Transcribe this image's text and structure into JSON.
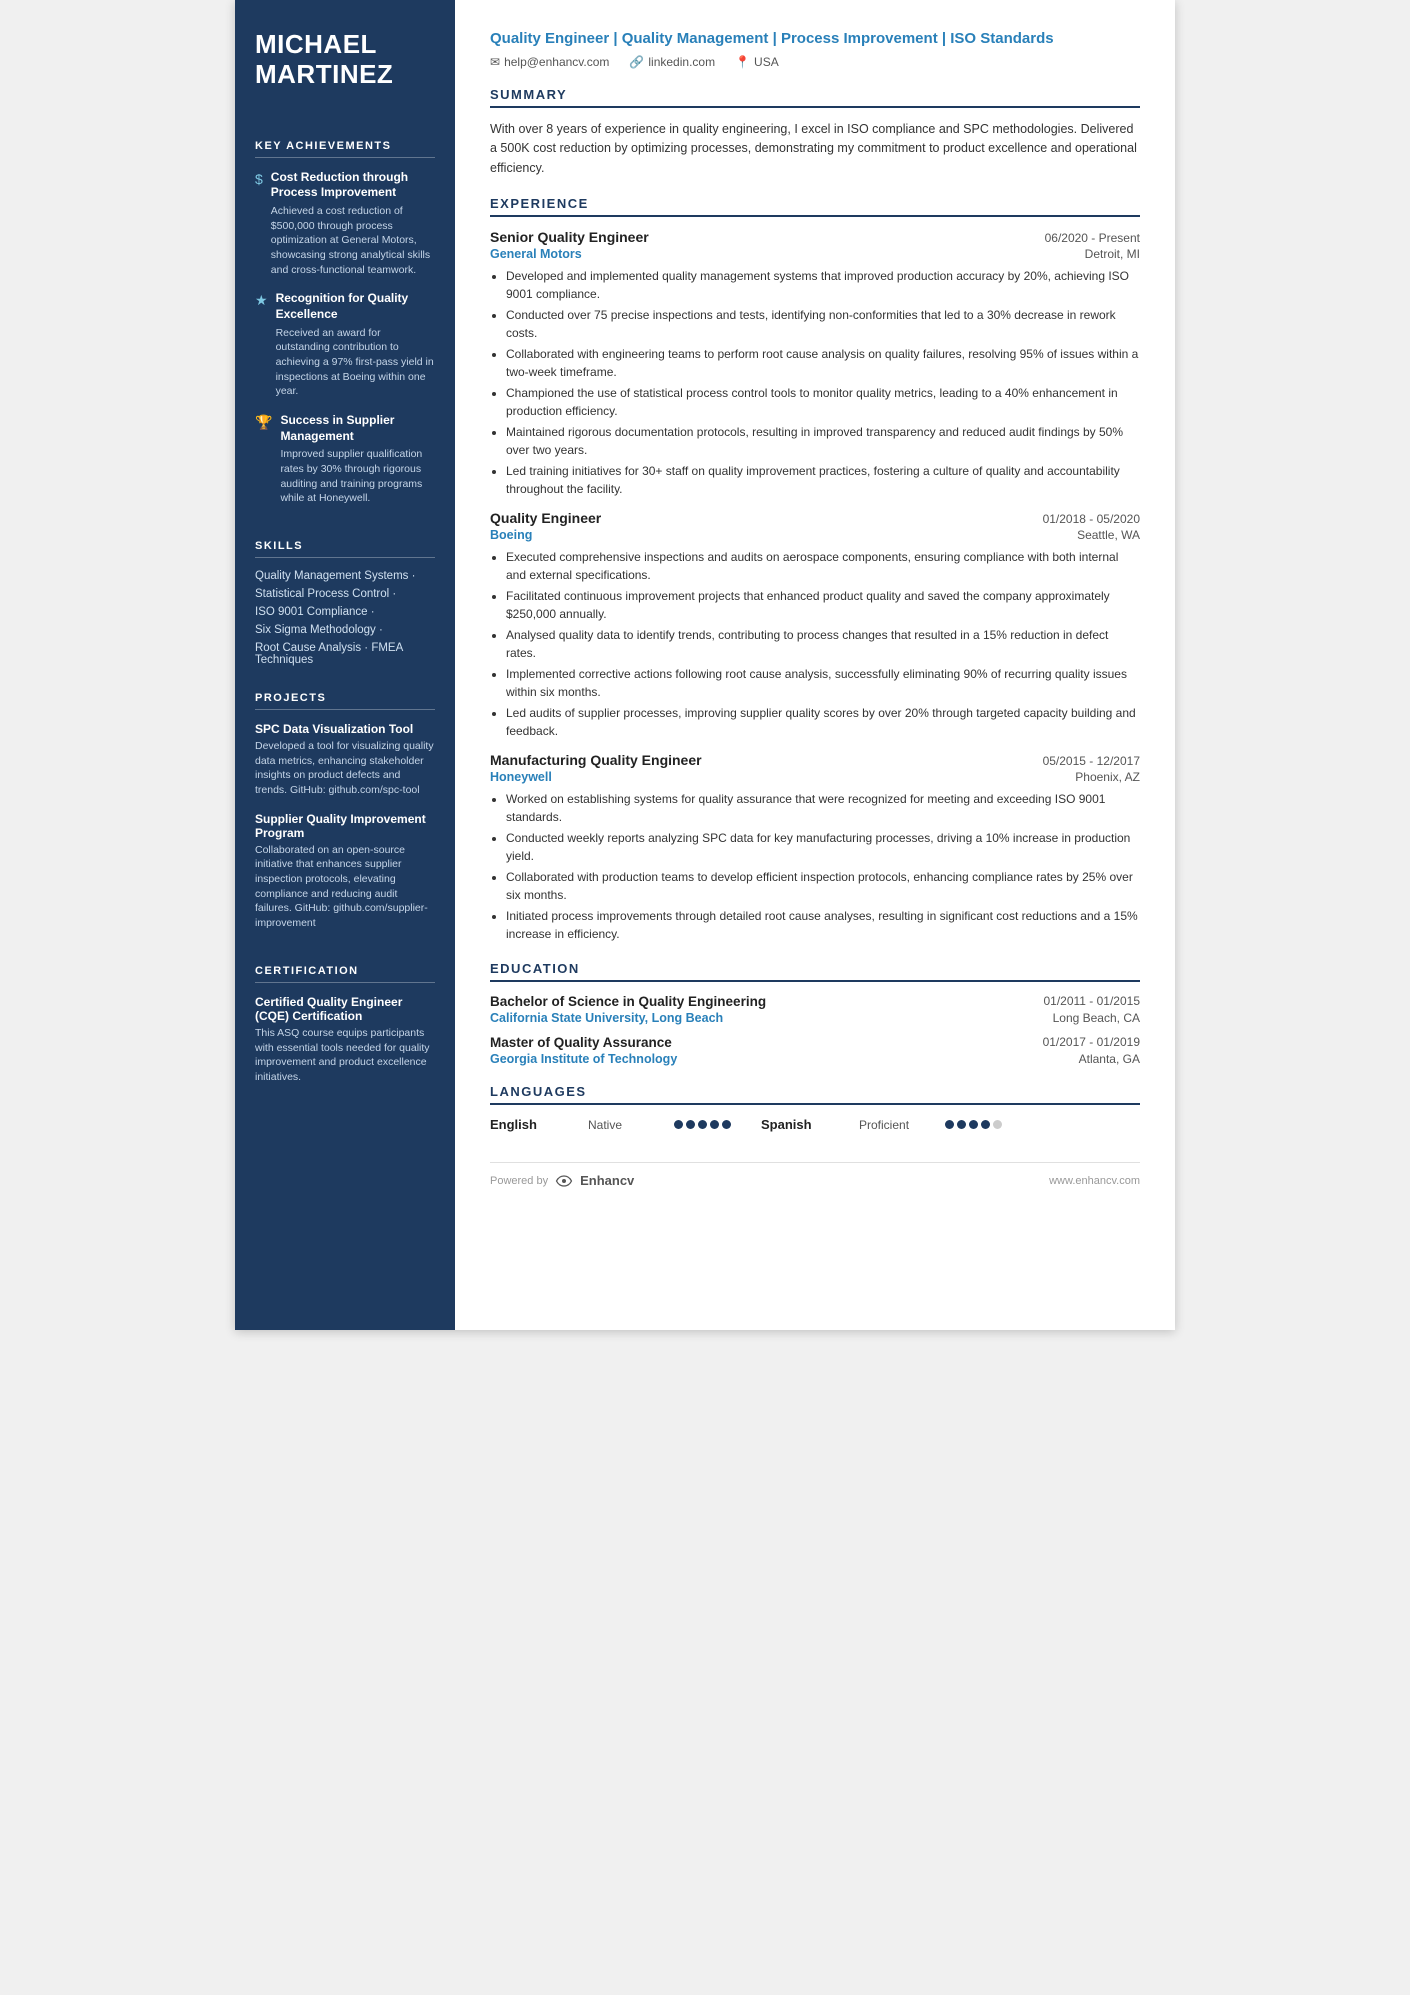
{
  "sidebar": {
    "name": "MICHAEL\nMARTINEZ",
    "achievements_title": "KEY ACHIEVEMENTS",
    "achievements": [
      {
        "icon": "$",
        "title": "Cost Reduction through Process Improvement",
        "desc": "Achieved a cost reduction of $500,000 through process optimization at General Motors, showcasing strong analytical skills and cross-functional teamwork."
      },
      {
        "icon": "★",
        "title": "Recognition for Quality Excellence",
        "desc": "Received an award for outstanding contribution to achieving a 97% first-pass yield in inspections at Boeing within one year."
      },
      {
        "icon": "🏆",
        "title": "Success in Supplier Management",
        "desc": "Improved supplier qualification rates by 30% through rigorous auditing and training programs while at Honeywell."
      }
    ],
    "skills_title": "SKILLS",
    "skills": [
      "Quality Management Systems ·",
      "Statistical Process Control ·",
      "ISO 9001 Compliance ·",
      "Six Sigma Methodology ·",
      "Root Cause Analysis · FMEA Techniques"
    ],
    "projects_title": "PROJECTS",
    "projects": [
      {
        "title": "SPC Data Visualization Tool",
        "desc": "Developed a tool for visualizing quality data metrics, enhancing stakeholder insights on product defects and trends. GitHub: github.com/spc-tool"
      },
      {
        "title": "Supplier Quality Improvement Program",
        "desc": "Collaborated on an open-source initiative that enhances supplier inspection protocols, elevating compliance and reducing audit failures. GitHub: github.com/supplier-improvement"
      }
    ],
    "cert_title": "CERTIFICATION",
    "cert": {
      "title": "Certified Quality Engineer (CQE) Certification",
      "desc": "This ASQ course equips participants with essential tools needed for quality improvement and product excellence initiatives."
    }
  },
  "main": {
    "title_line": "Quality Engineer | Quality Management | Process Improvement | ISO Standards",
    "contact": {
      "email": "help@enhancv.com",
      "linkedin": "linkedin.com",
      "location": "USA"
    },
    "summary_title": "SUMMARY",
    "summary": "With over 8 years of experience in quality engineering, I excel in ISO compliance and SPC methodologies. Delivered a 500K cost reduction by optimizing processes, demonstrating my commitment to product excellence and operational efficiency.",
    "experience_title": "EXPERIENCE",
    "experiences": [
      {
        "title": "Senior Quality Engineer",
        "date": "06/2020 - Present",
        "company": "General Motors",
        "location": "Detroit, MI",
        "bullets": [
          "Developed and implemented quality management systems that improved production accuracy by 20%, achieving ISO 9001 compliance.",
          "Conducted over 75 precise inspections and tests, identifying non-conformities that led to a 30% decrease in rework costs.",
          "Collaborated with engineering teams to perform root cause analysis on quality failures, resolving 95% of issues within a two-week timeframe.",
          "Championed the use of statistical process control tools to monitor quality metrics, leading to a 40% enhancement in production efficiency.",
          "Maintained rigorous documentation protocols, resulting in improved transparency and reduced audit findings by 50% over two years.",
          "Led training initiatives for 30+ staff on quality improvement practices, fostering a culture of quality and accountability throughout the facility."
        ]
      },
      {
        "title": "Quality Engineer",
        "date": "01/2018 - 05/2020",
        "company": "Boeing",
        "location": "Seattle, WA",
        "bullets": [
          "Executed comprehensive inspections and audits on aerospace components, ensuring compliance with both internal and external specifications.",
          "Facilitated continuous improvement projects that enhanced product quality and saved the company approximately $250,000 annually.",
          "Analysed quality data to identify trends, contributing to process changes that resulted in a 15% reduction in defect rates.",
          "Implemented corrective actions following root cause analysis, successfully eliminating 90% of recurring quality issues within six months.",
          "Led audits of supplier processes, improving supplier quality scores by over 20% through targeted capacity building and feedback."
        ]
      },
      {
        "title": "Manufacturing Quality Engineer",
        "date": "05/2015 - 12/2017",
        "company": "Honeywell",
        "location": "Phoenix, AZ",
        "bullets": [
          "Worked on establishing systems for quality assurance that were recognized for meeting and exceeding ISO 9001 standards.",
          "Conducted weekly reports analyzing SPC data for key manufacturing processes, driving a 10% increase in production yield.",
          "Collaborated with production teams to develop efficient inspection protocols, enhancing compliance rates by 25% over six months.",
          "Initiated process improvements through detailed root cause analyses, resulting in significant cost reductions and a 15% increase in efficiency."
        ]
      }
    ],
    "education_title": "EDUCATION",
    "education": [
      {
        "degree": "Bachelor of Science in Quality Engineering",
        "date": "01/2011 - 01/2015",
        "school": "California State University, Long Beach",
        "location": "Long Beach, CA"
      },
      {
        "degree": "Master of Quality Assurance",
        "date": "01/2017 - 01/2019",
        "school": "Georgia Institute of Technology",
        "location": "Atlanta, GA"
      }
    ],
    "languages_title": "LANGUAGES",
    "languages": [
      {
        "name": "English",
        "level": "Native",
        "dots": 5,
        "total": 5
      },
      {
        "name": "Spanish",
        "level": "Proficient",
        "dots": 4,
        "total": 5
      }
    ],
    "footer": {
      "powered_by": "Powered by",
      "brand": "Enhancv",
      "website": "www.enhancv.com"
    }
  }
}
